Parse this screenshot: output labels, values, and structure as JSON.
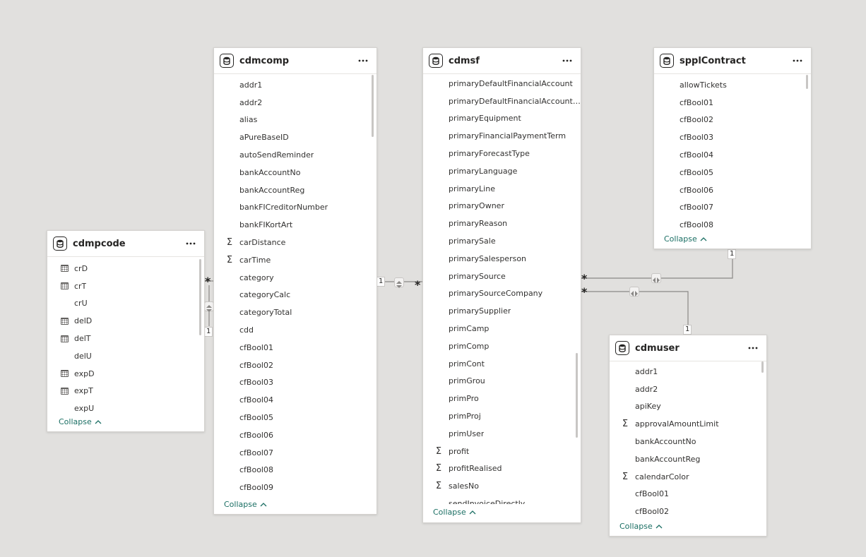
{
  "colors": {
    "canvas": "#e1e0de",
    "accent": "#1b6f64",
    "line": "#8a8886"
  },
  "collapse_label": "Collapse",
  "cards": {
    "cdmpcode": {
      "title": "cdmpcode",
      "fields": [
        {
          "name": "crD",
          "icon": "calendar-icon"
        },
        {
          "name": "crT",
          "icon": "calendar-icon"
        },
        {
          "name": "crU",
          "icon": ""
        },
        {
          "name": "delD",
          "icon": "calendar-icon"
        },
        {
          "name": "delT",
          "icon": "calendar-icon"
        },
        {
          "name": "delU",
          "icon": ""
        },
        {
          "name": "expD",
          "icon": "calendar-icon"
        },
        {
          "name": "expT",
          "icon": "calendar-icon"
        },
        {
          "name": "expU",
          "icon": ""
        }
      ]
    },
    "cdmcomp": {
      "title": "cdmcomp",
      "fields": [
        {
          "name": "addr1",
          "icon": ""
        },
        {
          "name": "addr2",
          "icon": ""
        },
        {
          "name": "alias",
          "icon": ""
        },
        {
          "name": "aPureBaseID",
          "icon": ""
        },
        {
          "name": "autoSendReminder",
          "icon": ""
        },
        {
          "name": "bankAccountNo",
          "icon": ""
        },
        {
          "name": "bankAccountReg",
          "icon": ""
        },
        {
          "name": "bankFICreditorNumber",
          "icon": ""
        },
        {
          "name": "bankFIKortArt",
          "icon": ""
        },
        {
          "name": "carDistance",
          "icon": "sigma-icon"
        },
        {
          "name": "carTime",
          "icon": "sigma-icon"
        },
        {
          "name": "category",
          "icon": ""
        },
        {
          "name": "categoryCalc",
          "icon": ""
        },
        {
          "name": "categoryTotal",
          "icon": ""
        },
        {
          "name": "cdd",
          "icon": ""
        },
        {
          "name": "cfBool01",
          "icon": ""
        },
        {
          "name": "cfBool02",
          "icon": ""
        },
        {
          "name": "cfBool03",
          "icon": ""
        },
        {
          "name": "cfBool04",
          "icon": ""
        },
        {
          "name": "cfBool05",
          "icon": ""
        },
        {
          "name": "cfBool06",
          "icon": ""
        },
        {
          "name": "cfBool07",
          "icon": ""
        },
        {
          "name": "cfBool08",
          "icon": ""
        },
        {
          "name": "cfBool09",
          "icon": ""
        }
      ]
    },
    "cdmsf": {
      "title": "cdmsf",
      "fields": [
        {
          "name": "primaryDefaultFinancialAccount",
          "icon": ""
        },
        {
          "name": "primaryDefaultFinancialAccountS…",
          "icon": ""
        },
        {
          "name": "primaryEquipment",
          "icon": ""
        },
        {
          "name": "primaryFinancialPaymentTerm",
          "icon": ""
        },
        {
          "name": "primaryForecastType",
          "icon": ""
        },
        {
          "name": "primaryLanguage",
          "icon": ""
        },
        {
          "name": "primaryLine",
          "icon": ""
        },
        {
          "name": "primaryOwner",
          "icon": ""
        },
        {
          "name": "primaryReason",
          "icon": ""
        },
        {
          "name": "primarySale",
          "icon": ""
        },
        {
          "name": "primarySalesperson",
          "icon": ""
        },
        {
          "name": "primarySource",
          "icon": ""
        },
        {
          "name": "primarySourceCompany",
          "icon": ""
        },
        {
          "name": "primarySupplier",
          "icon": ""
        },
        {
          "name": "primCamp",
          "icon": ""
        },
        {
          "name": "primComp",
          "icon": ""
        },
        {
          "name": "primCont",
          "icon": ""
        },
        {
          "name": "primGrou",
          "icon": ""
        },
        {
          "name": "primPro",
          "icon": ""
        },
        {
          "name": "primProj",
          "icon": ""
        },
        {
          "name": "primUser",
          "icon": ""
        },
        {
          "name": "profit",
          "icon": "sigma-icon"
        },
        {
          "name": "profitRealised",
          "icon": "sigma-icon"
        },
        {
          "name": "salesNo",
          "icon": "sigma-icon"
        },
        {
          "name": "sendInvoiceDirectly",
          "icon": ""
        }
      ]
    },
    "spplContract": {
      "title": "spplContract",
      "fields": [
        {
          "name": "allowTickets",
          "icon": ""
        },
        {
          "name": "cfBool01",
          "icon": ""
        },
        {
          "name": "cfBool02",
          "icon": ""
        },
        {
          "name": "cfBool03",
          "icon": ""
        },
        {
          "name": "cfBool04",
          "icon": ""
        },
        {
          "name": "cfBool05",
          "icon": ""
        },
        {
          "name": "cfBool06",
          "icon": ""
        },
        {
          "name": "cfBool07",
          "icon": ""
        },
        {
          "name": "cfBool08",
          "icon": ""
        }
      ]
    },
    "cdmuser": {
      "title": "cdmuser",
      "fields": [
        {
          "name": "addr1",
          "icon": ""
        },
        {
          "name": "addr2",
          "icon": ""
        },
        {
          "name": "apiKey",
          "icon": ""
        },
        {
          "name": "approvalAmountLimit",
          "icon": "sigma-icon"
        },
        {
          "name": "bankAccountNo",
          "icon": ""
        },
        {
          "name": "bankAccountReg",
          "icon": ""
        },
        {
          "name": "calendarColor",
          "icon": "sigma-icon"
        },
        {
          "name": "cfBool01",
          "icon": ""
        },
        {
          "name": "cfBool02",
          "icon": ""
        }
      ]
    }
  },
  "relationships": {
    "one": "1",
    "many": "*"
  }
}
